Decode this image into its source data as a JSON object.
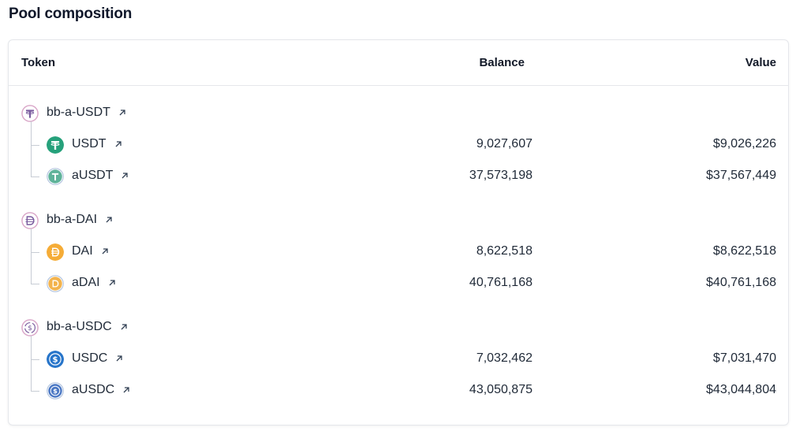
{
  "title": "Pool composition",
  "table": {
    "headers": {
      "token": "Token",
      "balance": "Balance",
      "value": "Value"
    },
    "groups": [
      {
        "label": "bb-a-USDT",
        "children": [
          {
            "label": "USDT",
            "balance": "9,027,607",
            "value": "$9,026,226"
          },
          {
            "label": "aUSDT",
            "balance": "37,573,198",
            "value": "$37,567,449"
          }
        ]
      },
      {
        "label": "bb-a-DAI",
        "children": [
          {
            "label": "DAI",
            "balance": "8,622,518",
            "value": "$8,622,518"
          },
          {
            "label": "aDAI",
            "balance": "40,761,168",
            "value": "$40,761,168"
          }
        ]
      },
      {
        "label": "bb-a-USDC",
        "children": [
          {
            "label": "USDC",
            "balance": "7,032,462",
            "value": "$7,031,470"
          },
          {
            "label": "aUSDC",
            "balance": "43,050,875",
            "value": "$43,044,804"
          }
        ]
      }
    ]
  },
  "icons": {
    "link": "external-link-arrow-icon",
    "tether": "#26a17b",
    "dai": "#f5ac37",
    "usdc": "#2775ca"
  }
}
